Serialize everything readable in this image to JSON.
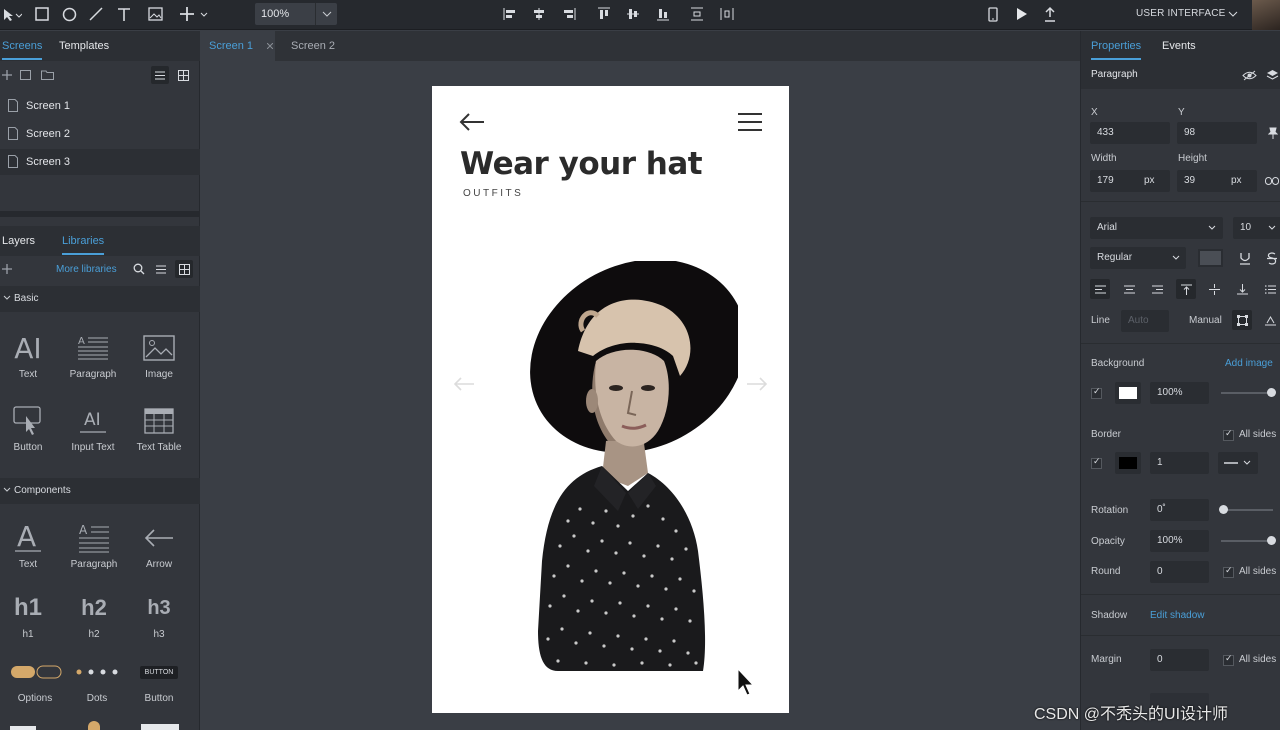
{
  "toolbar": {
    "zoom": "100%",
    "project_menu": "USER INTERFACE"
  },
  "left_panel": {
    "tabs": [
      "Screens",
      "Templates"
    ],
    "screens": [
      "Screen 1",
      "Screen 2",
      "Screen 3"
    ],
    "lib_tabs": [
      "Layers",
      "Libraries"
    ],
    "more_libraries": "More libraries",
    "basic": {
      "title": "Basic",
      "items": [
        "Text",
        "Paragraph",
        "Image",
        "Button",
        "Input Text",
        "Text Table"
      ]
    },
    "components": {
      "title": "Components",
      "items": [
        "Text",
        "Paragraph",
        "Arrow",
        "h1",
        "h2",
        "h3",
        "Options",
        "Dots",
        "Button"
      ],
      "glyphs": {
        "h1": "h1",
        "h2": "h2",
        "h3": "h3",
        "button_chip": "BUTTON"
      }
    }
  },
  "canvas": {
    "tabs": [
      "Screen 1",
      "Screen 2"
    ],
    "phone": {
      "title": "Wear your hat",
      "subtitle": "OUTFITS"
    }
  },
  "right_panel": {
    "tabs": [
      "Properties",
      "Events"
    ],
    "element_type": "Paragraph",
    "x_label": "X",
    "x": "433",
    "y_label": "Y",
    "y": "98",
    "width_label": "Width",
    "width": "179",
    "width_unit": "px",
    "height_label": "Height",
    "height": "39",
    "height_unit": "px",
    "font": "Arial",
    "font_size": "10",
    "font_weight": "Regular",
    "line_label": "Line",
    "line_value": "Auto",
    "manual_label": "Manual",
    "background_label": "Background",
    "add_image": "Add image",
    "bg_opacity": "100%",
    "border_label": "Border",
    "all_sides": "All sides",
    "border_width": "1",
    "rotation_label": "Rotation",
    "rotation": "0˚",
    "opacity_label": "Opacity",
    "opacity": "100%",
    "round_label": "Round",
    "round": "0",
    "shadow_label": "Shadow",
    "edit_shadow": "Edit shadow",
    "margin_label": "Margin",
    "margin": "0"
  },
  "watermark": "CSDN @不秃头的UI设计师"
}
